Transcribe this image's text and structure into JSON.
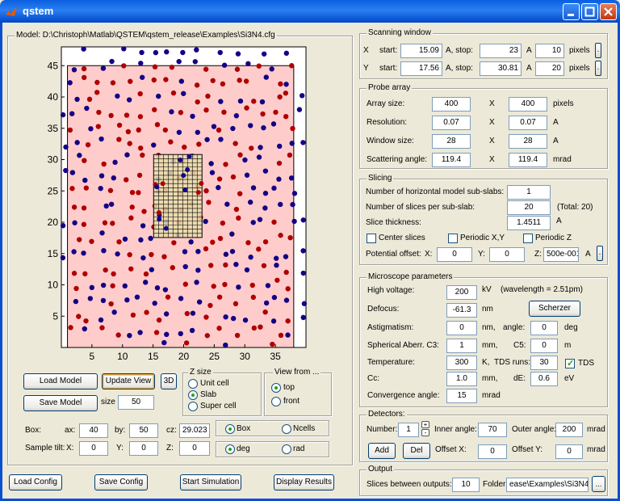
{
  "window": {
    "title": "qstem"
  },
  "model": {
    "title": "Model: D:\\Christoph\\Matlab\\QSTEM\\qstem_release\\Examples\\Si3N4.cfg"
  },
  "plot": {
    "y_ticks": [
      "45",
      "40",
      "35",
      "30",
      "25",
      "20",
      "15",
      "10",
      "5"
    ],
    "x_ticks": [
      "5",
      "10",
      "15",
      "20",
      "25",
      "30",
      "35"
    ],
    "xlim": [
      0,
      40
    ],
    "ylim": [
      0,
      48
    ],
    "supercell": [
      1,
      0,
      38,
      45
    ],
    "scan_box": [
      15.09,
      17.56,
      23,
      30.81
    ],
    "colors": {
      "red_atom": "#b00000",
      "blue_atom": "#140085",
      "cell_fill": "#ffcccc",
      "scan_fill": "#e8dcaa"
    }
  },
  "model_buttons": {
    "load": "Load Model",
    "update": "Update View",
    "view3d": "3D",
    "save": "Save Model",
    "size_label": "size",
    "size_value": "50"
  },
  "zsize": {
    "title": "Z size",
    "options": [
      "Unit cell",
      "Slab",
      "Super cell"
    ],
    "selected": 1
  },
  "viewfrom": {
    "title": "View from ...",
    "options": [
      "top",
      "front"
    ],
    "selected": 0
  },
  "box": {
    "label": "Box:",
    "ax_label": "ax:",
    "ax": "40",
    "by_label": "by:",
    "by": "50",
    "cz_label": "cz:",
    "cz": "29.023",
    "opt1": "Box",
    "opt2": "Ncells"
  },
  "tilt": {
    "label": "Sample tilt:",
    "x_label": "X:",
    "x": "0",
    "y_label": "Y:",
    "y": "0",
    "z_label": "Z:",
    "z": "0",
    "opt1": "deg",
    "opt2": "rad"
  },
  "bottom_buttons": {
    "load_config": "Load Config",
    "save_config": "Save Config",
    "start": "Start Simulation",
    "display": "Display Results"
  },
  "scan": {
    "title": "Scanning window",
    "x_label": "X",
    "y_label": "Y",
    "start_label": "start:",
    "stop_label": "A,  stop:",
    "a_label": "A",
    "pixels": "pixels",
    "x_start": "15.09",
    "x_stop": "23",
    "x_pixels": "10",
    "y_start": "17.56",
    "y_stop": "30.81",
    "y_pixels": "20",
    "btn": "."
  },
  "probe": {
    "title": "Probe array",
    "rows": [
      {
        "label": "Array size:",
        "v1": "400",
        "v2": "400",
        "unit": "pixels"
      },
      {
        "label": "Resolution:",
        "v1": "0.07",
        "v2": "0.07",
        "unit": "A"
      },
      {
        "label": "Window size:",
        "v1": "28",
        "v2": "28",
        "unit": "A"
      },
      {
        "label": "Scattering angle:",
        "v1": "119.4",
        "v2": "119.4",
        "unit": "mrad"
      }
    ],
    "x": "X"
  },
  "slicing": {
    "title": "Slicing",
    "sub_slabs_label": "Number of horizontal model sub-slabs:",
    "sub_slabs": "1",
    "slices_label": "Number of slices per sub-slab:",
    "slices": "20",
    "total": "(Total: 20)",
    "thickness_label": "Slice thickness:",
    "thickness": "1.4511",
    "thickness_unit": "A",
    "center": "Center slices",
    "periodic_xy": "Periodic X,Y",
    "periodic_z": "Periodic Z",
    "offset_label": "Potential offset:",
    "ox_label": "X:",
    "ox": "0",
    "oy_label": "Y:",
    "oy": "0",
    "oz_label": "Z:",
    "oz": "500e-001",
    "ounit": "A",
    "obtn": "."
  },
  "micro": {
    "title": "Microscope parameters",
    "hv_label": "High voltage:",
    "hv": "200",
    "hv_unit": "kV",
    "wavelength": "(wavelength = 2.51pm)",
    "defocus_label": "Defocus:",
    "defocus": "-61.3",
    "defocus_unit": "nm",
    "scherzer": "Scherzer",
    "astig_label": "Astigmatism:",
    "astig": "0",
    "astig_unit": "nm,",
    "angle_label": "angle:",
    "angle": "0",
    "angle_unit": "deg",
    "c3_label": "Spherical Aberr.  C3:",
    "c3": "1",
    "c3_unit": "mm,",
    "c5_label": "C5:",
    "c5": "0",
    "c5_unit": "m",
    "temp_label": "Temperature:",
    "temp": "300",
    "temp_unit": "K,",
    "tds_runs_label": "TDS runs:",
    "tds_runs": "30",
    "tds": "TDS",
    "cc_label": "Cc:",
    "cc": "1.0",
    "cc_unit": "mm,",
    "de_label": "dE:",
    "de": "0.6",
    "de_unit": "eV",
    "conv_label": "Convergence angle:",
    "conv": "15",
    "conv_unit": "mrad"
  },
  "detectors": {
    "title": "Detectors:",
    "number_label": "Number:",
    "number": "1",
    "inner_label": "Inner angle:",
    "inner": "70",
    "outer_label": "Outer angle:",
    "outer": "200",
    "mrad": "mrad",
    "add": "Add",
    "del": "Del",
    "offx_label": "Offset X:",
    "offx": "0",
    "offy_label": "Offset Y:",
    "offy": "0"
  },
  "output": {
    "title": "Output",
    "between_label": "Slices between outputs:",
    "between": "10",
    "folder_label": "Folder:",
    "folder": "ease\\Examples\\Si3N4",
    "btn": "..."
  }
}
